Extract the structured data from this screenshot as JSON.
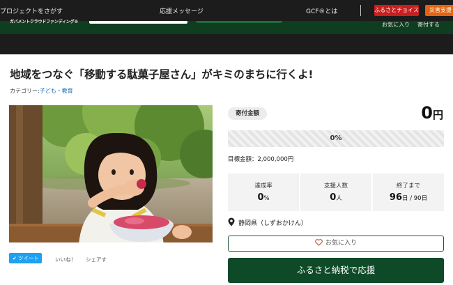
{
  "header": {
    "find_projects": "プロジェクトをさがす",
    "support_messages": "応援メッセージ",
    "about_gcf": "GCF®とは",
    "furusato_choice": "ふるさとチョイス",
    "disaster_support": "災害支援",
    "logo_subtitle": "ガバメントクラウドファンディング®",
    "favorites": "お気に入り",
    "history": "寄付する"
  },
  "project": {
    "title": "地域をつなぐ「移動する駄菓子屋さん」がキミのまちに行くよ!",
    "category_label": "カテゴリー:",
    "category": "子ども・教育"
  },
  "share": {
    "tweet": "ツイート",
    "like": "いいね！",
    "share": "シェアす"
  },
  "donation": {
    "badge": "寄付金額",
    "amount": "0",
    "currency": "円",
    "progress_text": "0%",
    "progress_fraction": 0,
    "goal": "目標金額：2,000,000円"
  },
  "stats": {
    "achievement_label": "達成率",
    "achievement_value": "0",
    "achievement_unit": "%",
    "supporters_label": "支援人数",
    "supporters_value": "0",
    "supporters_unit": "人",
    "remaining_label": "終了まで",
    "remaining_value": "96",
    "remaining_unit": "日 / 90日"
  },
  "location": "静岡県（しずおかけん）",
  "actions": {
    "favorite": "お気に入り",
    "donate": "ふるさと納税で応援"
  },
  "colors": {
    "header_bg": "#1c1c1c",
    "brand_green": "#0f4a28",
    "choice_red": "#c81e1e",
    "disaster_orange": "#e5630e",
    "tweet_blue": "#1da1f2"
  }
}
